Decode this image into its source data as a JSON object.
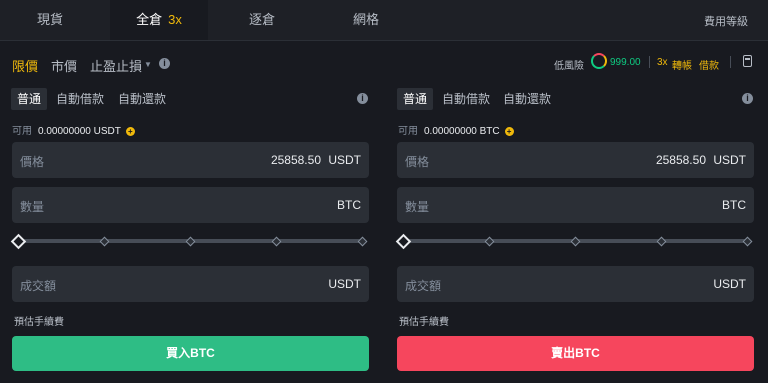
{
  "tabs": [
    {
      "label": "現貨"
    },
    {
      "label": "全倉",
      "leverage": "3x"
    },
    {
      "label": "逐倉"
    },
    {
      "label": "網格"
    }
  ],
  "fee_link": "費用等級",
  "order_types": {
    "limit": "限價",
    "market": "市價",
    "stop": "止盈止損"
  },
  "risk": {
    "label": "低風險",
    "value": "999.00"
  },
  "leverage_small": "3x",
  "transfer": "轉帳",
  "borrow": "借款",
  "buy_panel": {
    "subtabs": [
      "普通",
      "自動借款",
      "自動還款"
    ],
    "available_label": "可用",
    "available_value": "0.00000000 USDT",
    "price_label": "價格",
    "price_value": "25858.50",
    "price_unit": "USDT",
    "amount_label": "數量",
    "amount_unit": "BTC",
    "total_label": "成交額",
    "total_unit": "USDT",
    "fee_label": "預估手續費",
    "button": "買入BTC"
  },
  "sell_panel": {
    "subtabs": [
      "普通",
      "自動借款",
      "自動還款"
    ],
    "available_label": "可用",
    "available_value": "0.00000000 BTC",
    "price_label": "價格",
    "price_value": "25858.50",
    "price_unit": "USDT",
    "amount_label": "數量",
    "amount_unit": "BTC",
    "total_label": "成交額",
    "total_unit": "USDT",
    "fee_label": "預估手續費",
    "button": "賣出BTC"
  },
  "slider": {
    "value_percent": 0
  },
  "colors": {
    "accent": "#f0b90b",
    "buy": "#2ebd85",
    "sell": "#f6465d",
    "background": "#181a20",
    "input": "#2b2f36"
  },
  "icons": [
    "info-icon",
    "risk-gauge-icon",
    "calculator-icon",
    "plus-icon",
    "caret-down-icon"
  ]
}
